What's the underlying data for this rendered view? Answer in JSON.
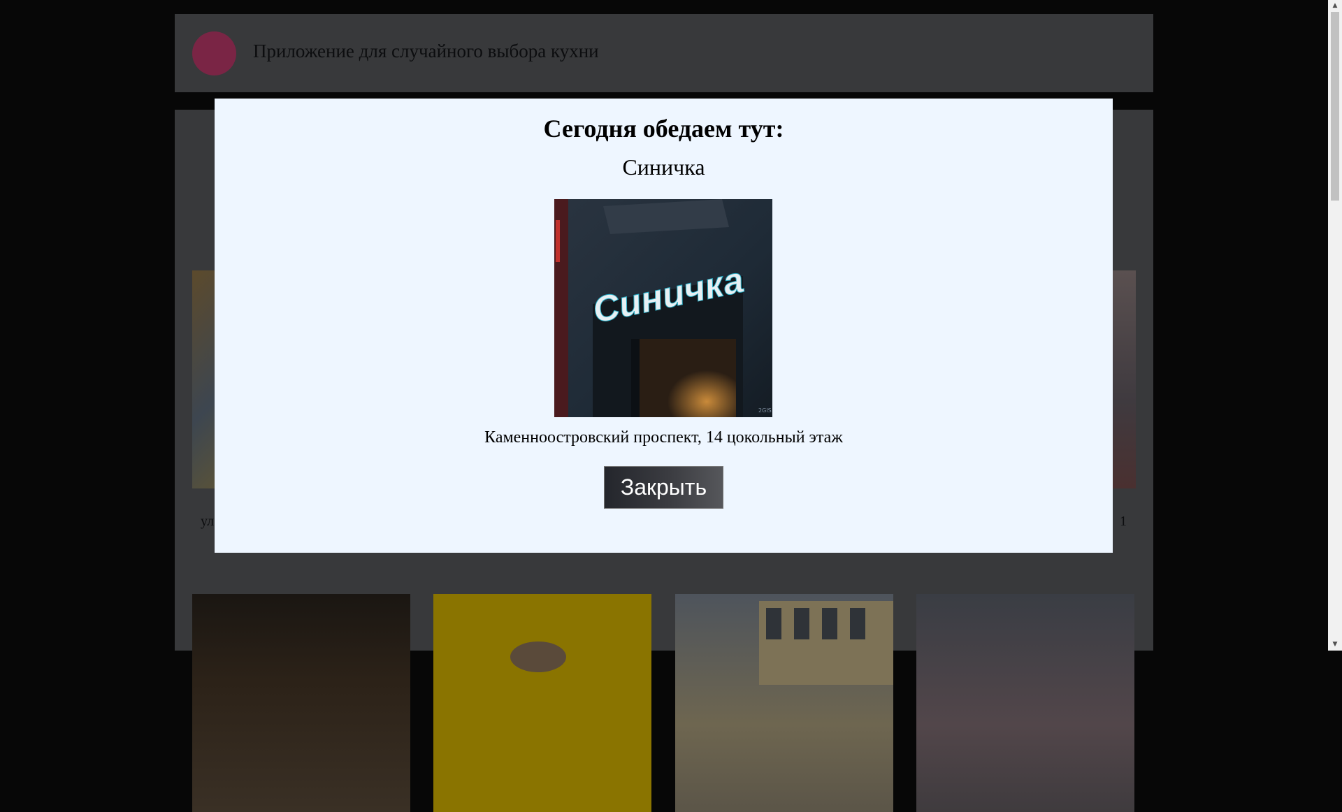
{
  "header": {
    "title": "Приложение для случайного выбора кухни"
  },
  "background_cards": {
    "partial_address_left": "ул",
    "partial_address_right": "1"
  },
  "modal": {
    "heading": "Сегодня обедаем тут:",
    "restaurant_name": "Синичка",
    "photo_sign_text": "Синичка",
    "address": "Каменноостровский проспект, 14 цокольный этаж",
    "close_label": "Закрыть"
  },
  "colors": {
    "overlay_dark": "#070707",
    "modal_background": "#eef6ff",
    "logo": "#7a2545",
    "button_dark": "#24262c"
  },
  "scrollbar": {
    "up_icon": "triangle-up-icon",
    "down_icon": "triangle-down-icon"
  }
}
